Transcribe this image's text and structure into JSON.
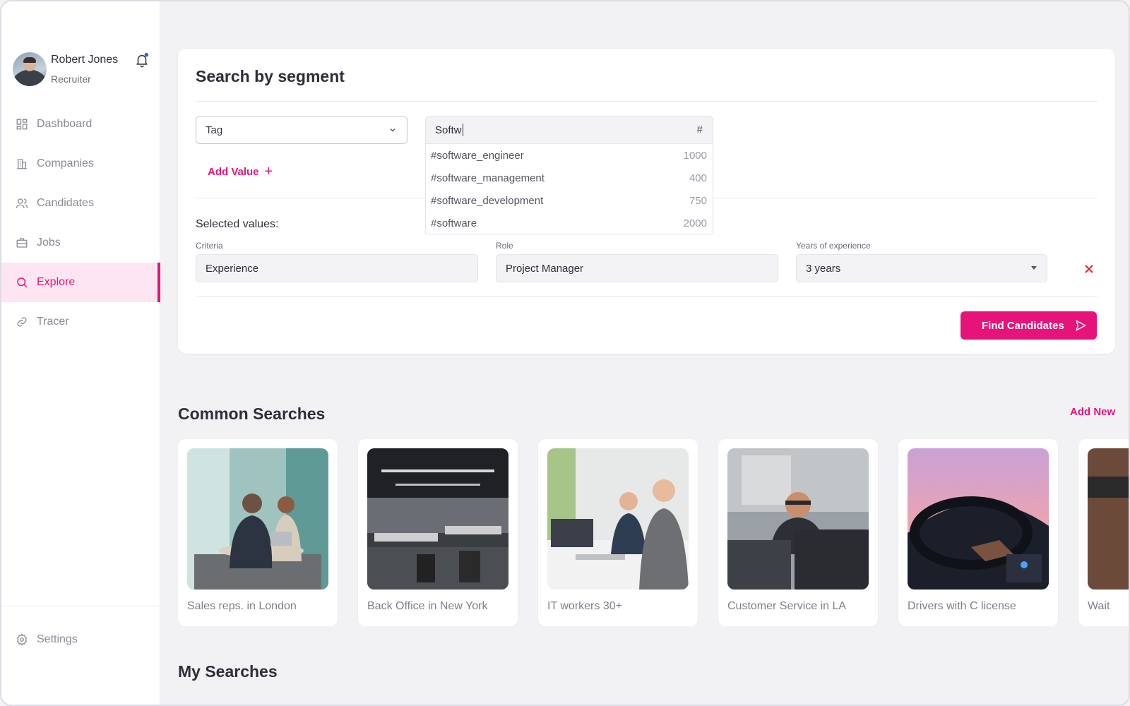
{
  "user": {
    "name": "Robert Jones",
    "role": "Recruiter"
  },
  "nav": {
    "items": [
      {
        "label": "Dashboard",
        "icon": "dashboard-icon"
      },
      {
        "label": "Companies",
        "icon": "building-icon"
      },
      {
        "label": "Candidates",
        "icon": "users-icon"
      },
      {
        "label": "Jobs",
        "icon": "briefcase-icon"
      },
      {
        "label": "Explore",
        "icon": "search-icon",
        "active": true
      },
      {
        "label": "Tracer",
        "icon": "link-icon"
      }
    ],
    "settings_label": "Settings"
  },
  "search_card": {
    "title": "Search by segment",
    "criteria_type": "Tag",
    "tag_input_value": "Softw",
    "hash_symbol": "#",
    "suggestions": [
      {
        "tag": "#software_engineer",
        "count": "1000"
      },
      {
        "tag": "#software_management",
        "count": "400"
      },
      {
        "tag": "#software_development",
        "count": "750"
      },
      {
        "tag": "#software",
        "count": "2000"
      }
    ],
    "add_value_label": "Add Value",
    "selected_values_label": "Selected values:",
    "fields": {
      "criteria": {
        "label": "Criteria",
        "value": "Experience"
      },
      "role": {
        "label": "Role",
        "value": "Project Manager"
      },
      "years": {
        "label": "Years of experience",
        "value": "3 years"
      }
    },
    "find_button_label": "Find Candidates"
  },
  "common_searches": {
    "title": "Common Searches",
    "add_new_label": "Add New",
    "items": [
      {
        "label": "Sales reps. in London"
      },
      {
        "label": "Back Office in New York"
      },
      {
        "label": "IT workers 30+"
      },
      {
        "label": "Customer Service in LA"
      },
      {
        "label": "Drivers with C license"
      },
      {
        "label": "Wait"
      }
    ]
  },
  "my_searches": {
    "title": "My Searches"
  },
  "colors": {
    "accent": "#e6137a",
    "accent_light": "#fde5f2",
    "danger": "#e02424"
  }
}
